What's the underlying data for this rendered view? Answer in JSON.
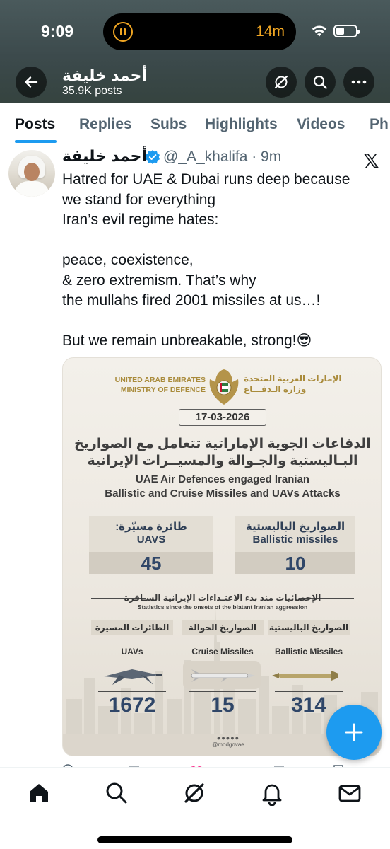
{
  "status_bar": {
    "time": "9:09",
    "live_activity_timer": "14m",
    "icons": [
      "pause-icon",
      "wifi-icon",
      "battery-icon"
    ]
  },
  "header": {
    "profile_name": "أحمد خليفة",
    "posts_count": "35.9K posts",
    "icons": [
      "back-arrow-icon",
      "grok-icon",
      "search-icon",
      "more-icon"
    ]
  },
  "tabs": [
    {
      "label": "Posts",
      "active": true
    },
    {
      "label": "Replies"
    },
    {
      "label": "Subs"
    },
    {
      "label": "Highlights"
    },
    {
      "label": "Videos"
    },
    {
      "label": "Ph"
    }
  ],
  "tweet": {
    "author_name": "أحمد خليفة",
    "handle": "@_A_khalifa · 9m",
    "verified": true,
    "text": "Hatred for UAE & Dubai runs deep because\nwe stand for everything\nIran’s evil regime hates:\n\npeace, coexistence,\n& zero extremism. That’s why\nthe mullahs fired 2001 missiles at us…!\n\nBut we remain unbreakable, strong!😎"
  },
  "infographic": {
    "org_en_line1": "UNITED ARAB EMIRATES",
    "org_en_line2": "MINISTRY OF DEFENCE",
    "org_ar_line1": "الإمارات العربية المتحدة",
    "org_ar_line2": "وزارة الـدفـــاع",
    "date": "17-03-2026",
    "headline_ar_line1": "الدفاعات الجوية الإماراتية تتعامل مع الصواريخ",
    "headline_ar_line2": "البـاليستية والجـوالة والمسيــرات الإيرانية",
    "headline_en_line1": "UAE Air Defences engaged Iranian",
    "headline_en_line2": "Ballistic and Cruise Missiles and UAVs Attacks",
    "today": {
      "uavs": {
        "label_ar": "طائرة مسيّرة:",
        "label_en": "UAVS",
        "value": "45"
      },
      "ballistic": {
        "label_ar": "الصواريخ الباليستية",
        "label_en": "Ballistic missiles",
        "value": "10"
      }
    },
    "stats_heading_ar": "الإحصائيات منذ بدء الاعتـداءات الإيرانية السـافرة",
    "stats_heading_en": "Statistics since the onsets of the blatant Iranian aggression",
    "totals": {
      "uavs": {
        "label_ar": "الطائرات المسيرة",
        "label_en": "UAVs",
        "value": "1672"
      },
      "cruise": {
        "label_ar": "الصواريخ الجوالة",
        "label_en": "Cruise Missiles",
        "value": "15"
      },
      "ballistic": {
        "label_ar": "الصواريخ الباليستية",
        "label_en": "Ballistic Missiles",
        "value": "314"
      }
    },
    "social_handle": "@modgovae",
    "colors": {
      "gold": "#a98b3b",
      "navy": "#2f4668",
      "box": "#e3ded4"
    }
  },
  "fab": {
    "icon": "plus-icon",
    "color": "#1d9bf0"
  },
  "bottom_nav": {
    "items": [
      "home-icon",
      "search-icon",
      "grok-icon",
      "notifications-icon",
      "messages-icon"
    ],
    "active": "home-icon"
  }
}
